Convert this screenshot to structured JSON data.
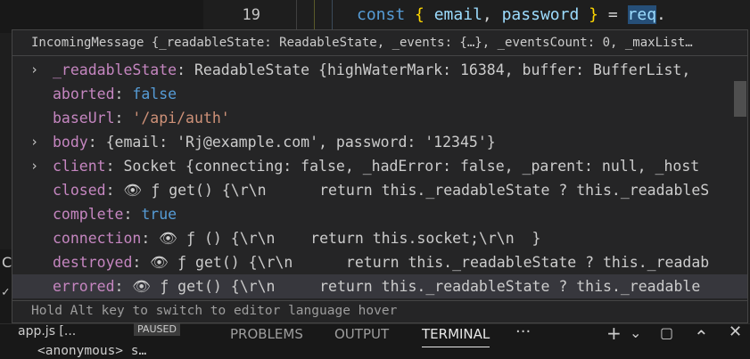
{
  "editor": {
    "line_number": "19",
    "code": {
      "kw": "const",
      "open": "{",
      "var1": "email",
      "comma": ",",
      "var2": "password",
      "close": "}",
      "eq": "=",
      "obj": "req",
      "dot": "."
    }
  },
  "hover": {
    "header": "IncomingMessage {_readableState: ReadableState, _events: {…}, _eventsCount: 0, _maxList…",
    "rows": [
      {
        "expandable": true,
        "key": "_readableState",
        "sep": ": ",
        "value": "ReadableState {highWaterMark: 16384, buffer: BufferList,",
        "vtype": "t"
      },
      {
        "expandable": false,
        "key": "aborted",
        "sep": ": ",
        "value": "false",
        "vtype": "b"
      },
      {
        "expandable": false,
        "key": "baseUrl",
        "sep": ": ",
        "value": "'/api/auth'",
        "vtype": "s"
      },
      {
        "expandable": true,
        "key": "body",
        "sep": ": ",
        "value": "{email: 'Rj@example.com', password: '12345'}",
        "vtype": "t"
      },
      {
        "expandable": true,
        "key": "client",
        "sep": ": ",
        "value": "Socket {connecting: false, _hadError: false, _parent: null, _host",
        "vtype": "t"
      },
      {
        "expandable": false,
        "key": "closed",
        "sep": ": ",
        "getter": true,
        "value": "ƒ get() {\\r\\n      return this._readableState ? this._readableS",
        "vtype": "t"
      },
      {
        "expandable": false,
        "key": "complete",
        "sep": ": ",
        "value": "true",
        "vtype": "b"
      },
      {
        "expandable": false,
        "key": "connection",
        "sep": ": ",
        "getter": true,
        "value": "ƒ () {\\r\\n    return this.socket;\\r\\n  }",
        "vtype": "t"
      },
      {
        "expandable": false,
        "key": "destroyed",
        "sep": ": ",
        "getter": true,
        "value": "ƒ get() {\\r\\n      return this._readableState ? this._readab",
        "vtype": "t"
      },
      {
        "expandable": false,
        "key": "errored",
        "sep": ": ",
        "getter": true,
        "value": "ƒ get() {\\r\\n     return this._readableState ? this._readable",
        "vtype": "t"
      }
    ],
    "footer": "Hold Alt key to switch to editor language hover",
    "expand_glyph": "›",
    "eye_glyph": "👁"
  },
  "left": {
    "letter": "C",
    "check": "✓"
  },
  "bottom": {
    "callstack_item": "app.js [...",
    "paused": "PAUSED",
    "anonymous": "<anonymous>  s…",
    "tabs": [
      "PROBLEMS",
      "OUTPUT",
      "TERMINAL"
    ],
    "active_tab": "TERMINAL",
    "more": "···",
    "add": "+",
    "dropdown": "⌄",
    "maximize": "⌃",
    "close": "✕",
    "layout": "▢"
  }
}
